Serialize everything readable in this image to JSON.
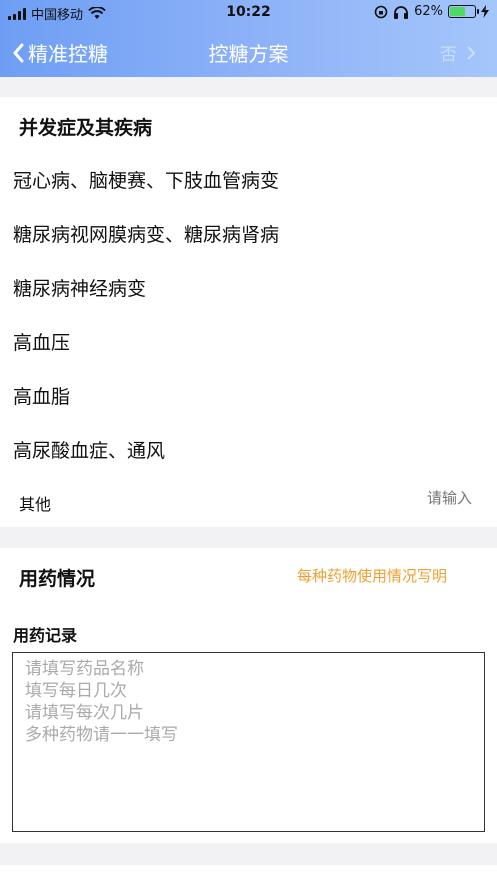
{
  "status_bar": {
    "carrier": "中国移动",
    "time": "10:22",
    "battery_percent": "62%",
    "battery_level": 0.62
  },
  "nav": {
    "back_label": "精准控糖",
    "title": "控糖方案",
    "right_label": "否"
  },
  "complications": {
    "title": "并发症及其疾病",
    "items": [
      "冠心病、脑梗赛、下肢血管病变",
      "糖尿病视网膜病变、糖尿病肾病",
      "糖尿病神经病变",
      "高血压",
      "高血脂",
      "高尿酸血症、通风"
    ],
    "other_label": "其他",
    "other_placeholder": "请输入"
  },
  "medication": {
    "title": "用药情况",
    "hint": "每种药物使用情况写明",
    "record_label": "用药记录",
    "record_placeholder_lines": [
      "请填写药品名称",
      "填写每日几次",
      "请填写每次几片",
      "多种药物请一一填写"
    ]
  },
  "colors": {
    "header_gradient_start": "#6e9ef4",
    "header_gradient_end": "#a5c6fa",
    "hint_orange": "#f0a030",
    "placeholder_gray": "#aaaaaa"
  },
  "icons": [
    "signal-icon",
    "wifi-icon",
    "lock-rotation-icon",
    "headphones-icon",
    "battery-icon",
    "charging-icon",
    "back-chevron-icon",
    "forward-chevron-icon"
  ]
}
